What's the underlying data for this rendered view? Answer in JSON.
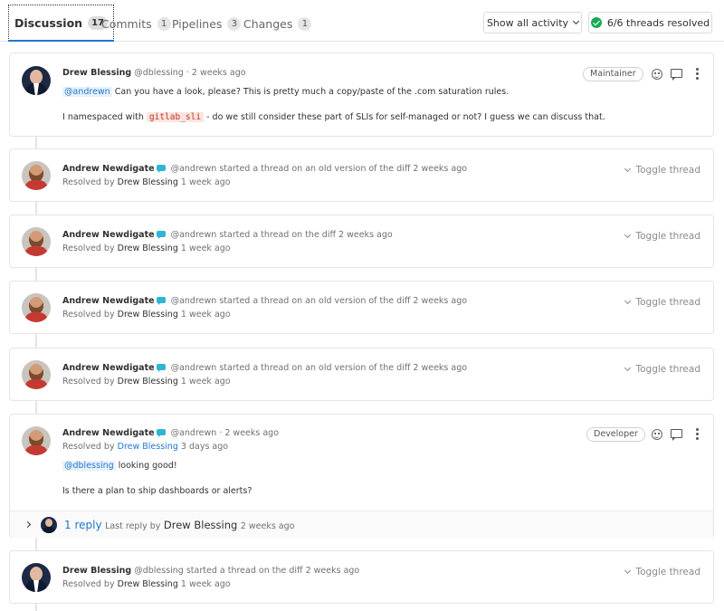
{
  "tabs": [
    {
      "label": "Discussion",
      "count": "17"
    },
    {
      "label": "Commits",
      "count": "1"
    },
    {
      "label": "Pipelines",
      "count": "3"
    },
    {
      "label": "Changes",
      "count": "1"
    }
  ],
  "header": {
    "activity_filter": "Show all activity",
    "threads_resolved": "6/6 threads resolved"
  },
  "comment1": {
    "author": "Drew Blessing",
    "meta": "@dblessing · 2 weeks ago",
    "role": "Maintainer",
    "mention": "@andrewn",
    "text1": "Can you have a look, please? This is pretty much a copy/paste of the .com saturation rules.",
    "text2a": "I namespaced with",
    "code": "gitlab_sli",
    "text2b": "- do we still consider these part of SLIs for self-managed or not? I guess we can discuss that."
  },
  "threads": [
    {
      "author": "Andrew Newdigate",
      "meta": "@andrewn started a thread on an old version of the diff 2 weeks ago",
      "resolved_label": "Resolved by",
      "resolver": "Drew Blessing",
      "when": "1 week ago",
      "toggle": "Toggle thread"
    },
    {
      "author": "Andrew Newdigate",
      "meta": "@andrewn started a thread on the diff 2 weeks ago",
      "resolved_label": "Resolved by",
      "resolver": "Drew Blessing",
      "when": "1 week ago",
      "toggle": "Toggle thread"
    },
    {
      "author": "Andrew Newdigate",
      "meta": "@andrewn started a thread on an old version of the diff 2 weeks ago",
      "resolved_label": "Resolved by",
      "resolver": "Drew Blessing",
      "when": "1 week ago",
      "toggle": "Toggle thread"
    },
    {
      "author": "Andrew Newdigate",
      "meta": "@andrewn started a thread on an old version of the diff 2 weeks ago",
      "resolved_label": "Resolved by",
      "resolver": "Drew Blessing",
      "when": "1 week ago",
      "toggle": "Toggle thread"
    }
  ],
  "comment2": {
    "author": "Andrew Newdigate",
    "meta": "@andrewn · 2 weeks ago",
    "resolved_label": "Resolved by",
    "resolver": "Drew Blessing",
    "when": "3 days ago",
    "role": "Developer",
    "mention": "@dblessing",
    "text1": "looking good!",
    "text2": "Is there a plan to ship dashboards or alerts?",
    "reply_count": "1 reply",
    "last_reply_label": "Last reply by",
    "last_reply_by": "Drew Blessing",
    "last_reply_when": "2 weeks ago"
  },
  "thread_last": {
    "author": "Drew Blessing",
    "meta": "@dblessing started a thread on the diff 2 weeks ago",
    "resolved_label": "Resolved by",
    "resolver": "Drew Blessing",
    "when": "1 week ago",
    "toggle": "Toggle thread"
  }
}
